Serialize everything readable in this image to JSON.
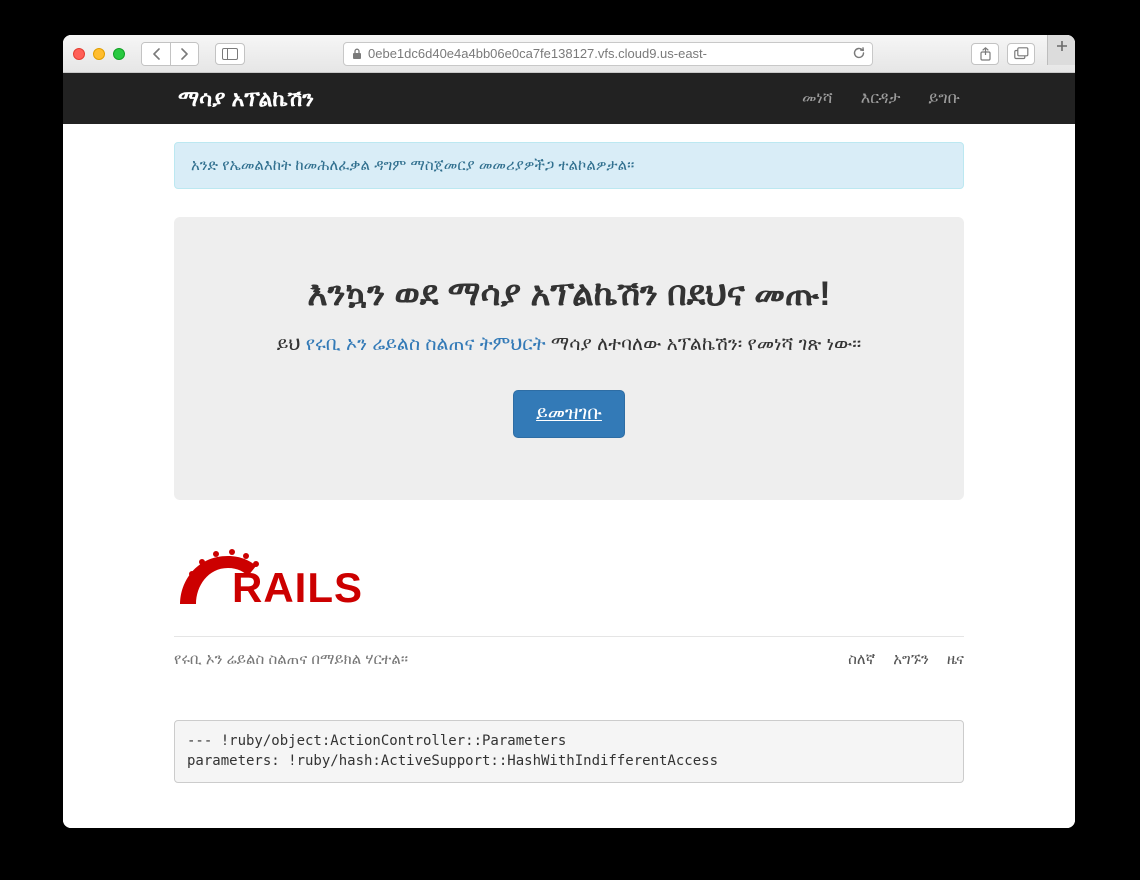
{
  "browser": {
    "url": "0ebe1dc6d40e4a4bb06e0ca7fe138127.vfs.cloud9.us-east-"
  },
  "nav": {
    "brand": "ማሳያ አፕልኬሽን",
    "links": [
      "መነሻ",
      "እርዳታ",
      "ይግቡ"
    ]
  },
  "alert": "አንድ የኤመልእከት ከመሕለፈቃል ዳግም ማስጀመርያ መመሪያዎችጋ ተልኮልዎታል፡፡",
  "jumbo": {
    "heading": "እንኳን ወደ ማሳያ አፕልኬሽን በደህና መጡ!",
    "lead_before": "ይህ ",
    "lead_link": "የሩቢ ኦን ሬይልስ ስልጠና ትምህርት",
    "lead_after": " ማሳያ ለተባለው አፕልኬሽን፡ የመነሻ ገጽ ነው፡፡",
    "button": "ይመዝገቡ"
  },
  "logo_text": "RAILS",
  "footer": {
    "text": "የሩቢ ኦን ሬይልስ ስልጠና በማይክል ሃርተል፡፡",
    "links": [
      "ስለኛ",
      "አግኙን",
      "ዜና"
    ]
  },
  "debug": "--- !ruby/object:ActionController::Parameters\nparameters: !ruby/hash:ActiveSupport::HashWithIndifferentAccess"
}
